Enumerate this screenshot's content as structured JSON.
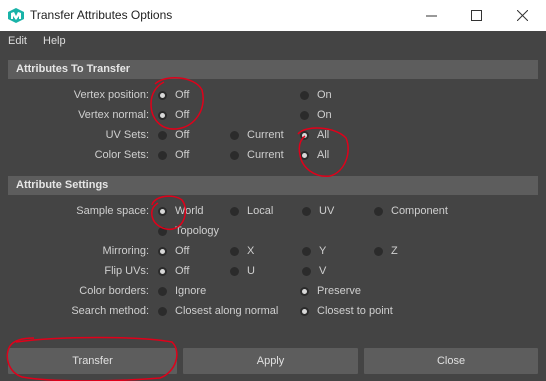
{
  "window": {
    "title": "Transfer Attributes Options"
  },
  "menu": [
    "Edit",
    "Help"
  ],
  "sections": {
    "transfer": {
      "title": "Attributes To Transfer",
      "rows": [
        {
          "label": "Vertex position:",
          "options": [
            "Off",
            "On"
          ],
          "selected": "Off"
        },
        {
          "label": "Vertex normal:",
          "options": [
            "Off",
            "On"
          ],
          "selected": "Off"
        },
        {
          "label": "UV Sets:",
          "options": [
            "Off",
            "Current",
            "All"
          ],
          "selected": "All"
        },
        {
          "label": "Color Sets:",
          "options": [
            "Off",
            "Current",
            "All"
          ],
          "selected": "All"
        }
      ]
    },
    "settings": {
      "title": "Attribute Settings",
      "rows": [
        {
          "label": "Sample space:",
          "options": [
            "World",
            "Local",
            "UV",
            "Component",
            "Topology"
          ],
          "selected": "World"
        },
        {
          "label": "Mirroring:",
          "options": [
            "Off",
            "X",
            "Y",
            "Z"
          ],
          "selected": "Off"
        },
        {
          "label": "Flip UVs:",
          "options": [
            "Off",
            "U",
            "V"
          ],
          "selected": "Off"
        },
        {
          "label": "Color borders:",
          "options": [
            "Ignore",
            "Preserve"
          ],
          "selected": "Preserve"
        },
        {
          "label": "Search method:",
          "options": [
            "Closest along normal",
            "Closest to point"
          ],
          "selected": "Closest to point"
        }
      ]
    }
  },
  "buttons": {
    "transfer": "Transfer",
    "apply": "Apply",
    "close": "Close"
  },
  "colors": {
    "background": "#444444",
    "section_header": "#5d5d5d",
    "annotation": "#e0001a",
    "app_icon": "#19b3a8"
  }
}
